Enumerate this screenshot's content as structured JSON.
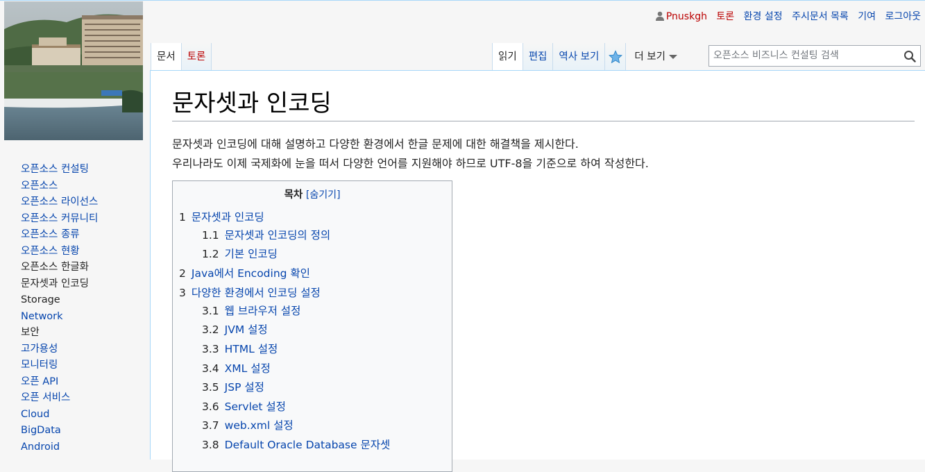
{
  "personal_tools": {
    "username": "Pnuskgh",
    "items": [
      "토론",
      "환경 설정",
      "주시문서 목록",
      "기여",
      "로그아웃"
    ]
  },
  "left_tabs": [
    "문서",
    "토론"
  ],
  "right_tabs": {
    "read": "읽기",
    "edit": "편집",
    "history": "역사 보기",
    "watch_icon": "star-icon",
    "more": "더 보기"
  },
  "search": {
    "placeholder": "오픈소스 비즈니스 컨설팅 검색",
    "icon": "search-icon"
  },
  "sidebar": {
    "items": [
      "오픈소스 컨설팅",
      "오픈소스",
      "오픈소스 라이선스",
      "오픈소스 커뮤니티",
      "오픈소스 종류",
      "오픈소스 현황",
      "오픈소스 한글화",
      "문자셋과 인코딩",
      "Storage",
      "Network",
      "보안",
      "고가용성",
      "모니터링",
      "오픈 API",
      "오픈 서비스",
      "Cloud",
      "BigData",
      "Android"
    ]
  },
  "article": {
    "title": "문자셋과 인코딩",
    "p1": "문자셋과 인코딩에 대해 설명하고 다양한 환경에서 한글 문제에 대한 해결책을 제시한다.",
    "p2": "우리나라도 이제 국제화에 눈을 떠서 다양한 언어를 지원해야 하므로 UTF-8을 기준으로 하여 작성한다."
  },
  "toc": {
    "title": "목차",
    "toggle": "[숨기기]",
    "items": [
      {
        "num": "1",
        "text": "문자셋과 인코딩"
      },
      {
        "num": "1.1",
        "text": "문자셋과 인코딩의 정의"
      },
      {
        "num": "1.2",
        "text": "기본 인코딩"
      },
      {
        "num": "2",
        "text": "Java에서 Encoding 확인"
      },
      {
        "num": "3",
        "text": "다양한 환경에서 인코딩 설정"
      },
      {
        "num": "3.1",
        "text": "웹 브라우저 설정"
      },
      {
        "num": "3.2",
        "text": "JVM 설정"
      },
      {
        "num": "3.3",
        "text": "HTML 설정"
      },
      {
        "num": "3.4",
        "text": "XML 설정"
      },
      {
        "num": "3.5",
        "text": "JSP 설정"
      },
      {
        "num": "3.6",
        "text": "Servlet 설정"
      },
      {
        "num": "3.7",
        "text": "web.xml 설정"
      },
      {
        "num": "3.8",
        "text": "Default Oracle Database 문자셋"
      }
    ]
  },
  "colors": {
    "link": "#0645ad",
    "new_link": "#ba0000",
    "tab_border": "#a7d7f9",
    "toc_bg": "#f8f9fa"
  }
}
